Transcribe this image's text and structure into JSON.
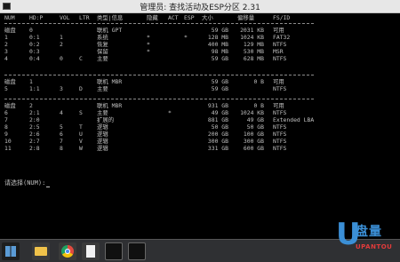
{
  "window": {
    "title": "管理员: 查找活动及ESP分区 2.31"
  },
  "table": {
    "headers": [
      "NUM",
      "HD:P",
      "VOL",
      "LTR",
      "类型|信息",
      "隐藏",
      "ACT",
      "ESP",
      "大小",
      "偏移量",
      "FS/ID"
    ],
    "rows": [
      [
        "磁盘",
        "0",
        "",
        "",
        "联机 GPT",
        "",
        "",
        "",
        "59 GB",
        "2031 KB",
        "可用"
      ],
      [
        "1",
        "0:1",
        "1",
        "",
        "系统",
        "*",
        "",
        "*",
        "128 MB",
        "1024 KB",
        "FAT32"
      ],
      [
        "2",
        "0:2",
        "2",
        "",
        "恢复",
        "*",
        "",
        "",
        "400 MB",
        "129 MB",
        "NTFS"
      ],
      [
        "3",
        "0:3",
        "",
        "",
        "保留",
        "*",
        "",
        "",
        "98 MB",
        "530 MB",
        "MSR"
      ],
      [
        "4",
        "0:4",
        "0",
        "C",
        "主要",
        "",
        "",
        "",
        "59 GB",
        "628 MB",
        "NTFS"
      ],
      [
        "磁盘",
        "1",
        "",
        "",
        "联机 MBR",
        "",
        "",
        "",
        "59 GB",
        "0 B",
        "可用"
      ],
      [
        "5",
        "1:1",
        "3",
        "D",
        "主要",
        "",
        "",
        "",
        "59 GB",
        "",
        "NTFS"
      ],
      [
        "磁盘",
        "2",
        "",
        "",
        "联机 MBR",
        "",
        "",
        "",
        "931 GB",
        "0 B",
        "可用"
      ],
      [
        "6",
        "2:1",
        "4",
        "S",
        "主要",
        "",
        "*",
        "",
        "49 GB",
        "1024 KB",
        "NTFS"
      ],
      [
        "7",
        "2:0",
        "",
        "",
        "扩展的",
        "",
        "",
        "",
        "881 GB",
        "49 GB",
        "Extended LBA"
      ],
      [
        "8",
        "2:5",
        "5",
        "T",
        "逻辑",
        "",
        "",
        "",
        "50 GB",
        "50 GB",
        "NTFS"
      ],
      [
        "9",
        "2:6",
        "6",
        "U",
        "逻辑",
        "",
        "",
        "",
        "200 GB",
        "100 GB",
        "NTFS"
      ],
      [
        "10",
        "2:7",
        "7",
        "V",
        "逻辑",
        "",
        "",
        "",
        "300 GB",
        "300 GB",
        "NTFS"
      ],
      [
        "11",
        "2:8",
        "8",
        "W",
        "逻辑",
        "",
        "",
        "",
        "331 GB",
        "600 GB",
        "NTFS"
      ]
    ]
  },
  "prompt": "请选择(NUM):",
  "logo": {
    "cn": "盘量",
    "en": "UPANTOU"
  }
}
